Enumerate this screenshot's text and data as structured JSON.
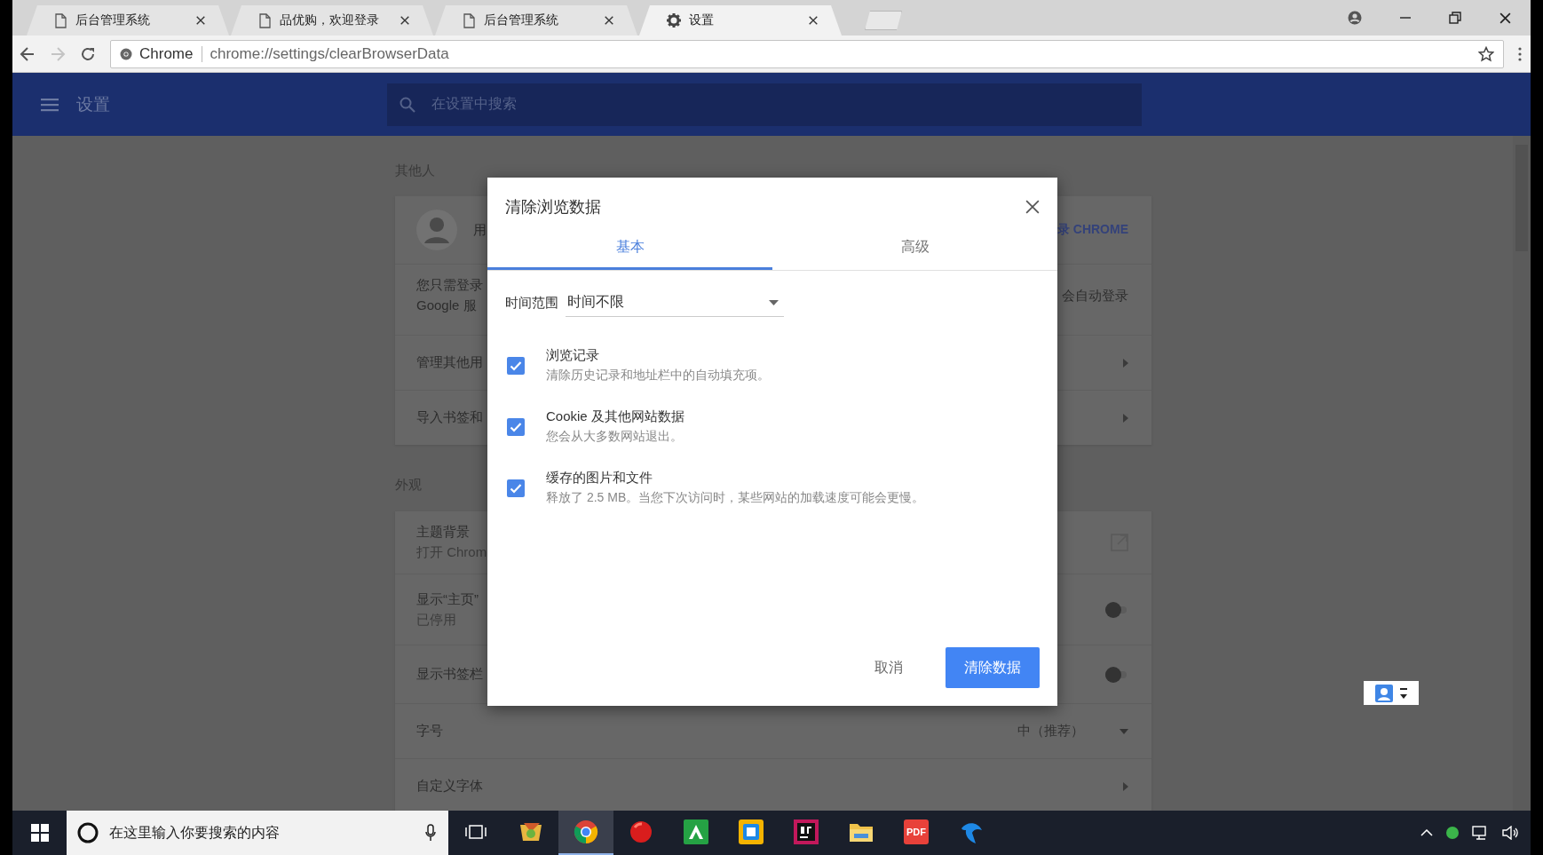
{
  "browser": {
    "tabs": [
      {
        "title": "后台管理系统",
        "kind": "page",
        "selected": false
      },
      {
        "title": "品优购，欢迎登录",
        "kind": "page",
        "selected": false
      },
      {
        "title": "后台管理系统",
        "kind": "page",
        "selected": false
      },
      {
        "title": "设置",
        "kind": "settings",
        "selected": true
      }
    ],
    "forward_disabled": true,
    "address": {
      "site_label": "Chrome",
      "url": "chrome://settings/clearBrowserData"
    }
  },
  "settings_page": {
    "header": {
      "title": "设置",
      "search_placeholder": "在设置中搜索"
    },
    "sections": [
      {
        "heading": "其他人",
        "rows": [
          {
            "kind": "person",
            "title": "用",
            "action": "录 CHROME"
          },
          {
            "kind": "text",
            "lines": [
              "您只需登录",
              "Google 服"
            ],
            "trailing": "会自动登录"
          },
          {
            "kind": "link",
            "title": "管理其他用"
          },
          {
            "kind": "link",
            "title": "导入书签和"
          }
        ]
      },
      {
        "heading": "外观",
        "rows": [
          {
            "kind": "external",
            "title": "主题背景",
            "subtitle": "打开 Chrom"
          },
          {
            "kind": "toggle",
            "title": "显示“主页”",
            "subtitle": "已停用",
            "on": false
          },
          {
            "kind": "toggle",
            "title": "显示书签栏",
            "on": false
          },
          {
            "kind": "select",
            "title": "字号",
            "value": "中（推荐）"
          },
          {
            "kind": "link",
            "title": "自定义字体"
          }
        ]
      }
    ]
  },
  "dialog": {
    "title": "清除浏览数据",
    "tabs": [
      {
        "label": "基本",
        "selected": true
      },
      {
        "label": "高级",
        "selected": false
      }
    ],
    "time_range": {
      "label": "时间范围",
      "value": "时间不限"
    },
    "items": [
      {
        "label": "浏览记录",
        "description": "清除历史记录和地址栏中的自动填充项。",
        "checked": true
      },
      {
        "label": "Cookie 及其他网站数据",
        "description": "您会从大多数网站退出。",
        "checked": true
      },
      {
        "label": "缓存的图片和文件",
        "description": "释放了 2.5 MB。当您下次访问时，某些网站的加载速度可能会更慢。",
        "checked": true
      }
    ],
    "buttons": [
      {
        "label": "取消",
        "kind": "text"
      },
      {
        "label": "清除数据",
        "kind": "primary"
      }
    ]
  },
  "taskbar": {
    "search_placeholder": "在这里输入你要搜索的内容",
    "apps": [
      {
        "kind": "paint",
        "selected": false
      },
      {
        "kind": "chrome",
        "selected": true
      },
      {
        "kind": "ball",
        "selected": false
      },
      {
        "kind": "mountain",
        "selected": false
      },
      {
        "kind": "square-app",
        "selected": false
      },
      {
        "kind": "ide",
        "selected": false
      },
      {
        "kind": "folder",
        "selected": false
      },
      {
        "kind": "pdf",
        "label": "PDF",
        "selected": false
      },
      {
        "kind": "bird",
        "selected": false
      }
    ]
  }
}
